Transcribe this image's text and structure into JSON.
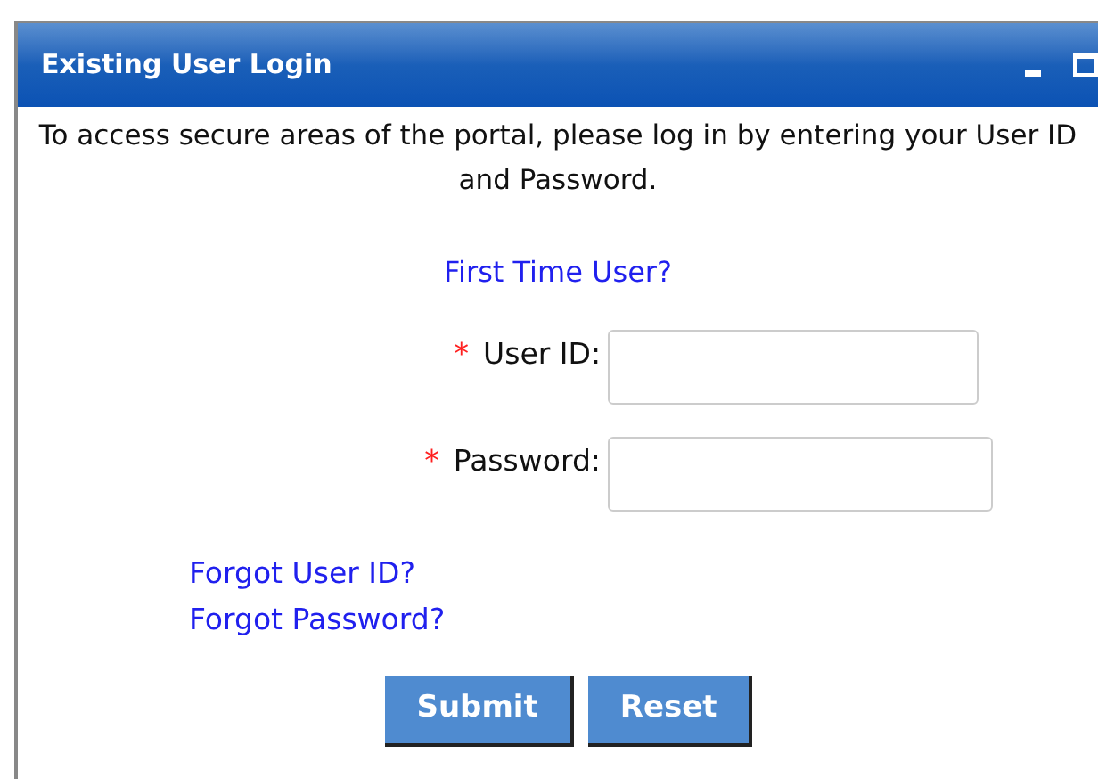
{
  "panel": {
    "title": "Existing User Login"
  },
  "intro": "To access secure areas of the portal, please log in by entering your User ID and Password.",
  "first_time_link": "First Time User?",
  "fields": [
    {
      "required_mark": "*",
      "label": "User ID:"
    },
    {
      "required_mark": "*",
      "label": "Password:"
    }
  ],
  "links": [
    "Forgot User ID?",
    "Forgot Password?"
  ],
  "buttons": [
    "Submit",
    "Reset"
  ]
}
